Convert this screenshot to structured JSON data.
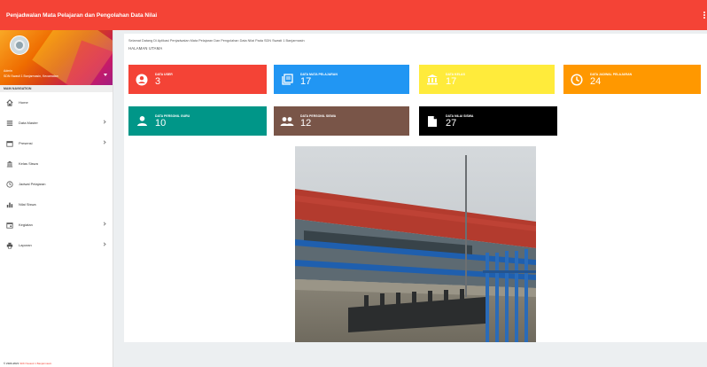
{
  "app": {
    "title": "Penjadwalan Mata Pelajaran dan Pengolahan Data Nilai"
  },
  "sidebar": {
    "user_name": "Admin",
    "user_school": "SDN Swasti 1 Banjarmasin, Kecamatan",
    "nav_header": "MAIN NAVIGATION",
    "items": [
      {
        "label": "Home",
        "icon": "home-icon",
        "has_submenu": false
      },
      {
        "label": "Data Master",
        "icon": "list-icon",
        "has_submenu": true
      },
      {
        "label": "Presensi",
        "icon": "calendar-icon",
        "has_submenu": true
      },
      {
        "label": "Kelas Siswa",
        "icon": "building-icon",
        "has_submenu": false
      },
      {
        "label": "Jadwal Pelajaran",
        "icon": "clock-icon",
        "has_submenu": false
      },
      {
        "label": "Nilai Siswa",
        "icon": "chart-icon",
        "has_submenu": false
      },
      {
        "label": "Kegiatan",
        "icon": "event-icon",
        "has_submenu": true
      },
      {
        "label": "Laporan",
        "icon": "print-icon",
        "has_submenu": true
      }
    ],
    "footer": "© 2020-2021",
    "footer_school": "SDN Swasti 1 Banjarmasin"
  },
  "main": {
    "welcome": "Selamat Datang Di Aplikasi Penjadwalan Mata Pelajaran Dan Pengolahan Data Nilai Pada SDN Swasti 1 Banjarmasin",
    "page_label": "HALAMAN UTAMA",
    "cards": [
      {
        "label": "DATA USER",
        "value": "3",
        "icon": "user-circle-icon",
        "color": "#f44336"
      },
      {
        "label": "DATA MATA PELAJARAN",
        "value": "17",
        "icon": "book-icon",
        "color": "#2196f3"
      },
      {
        "label": "DATA KELAS",
        "value": "17",
        "icon": "bank-icon",
        "color": "#ffeb3b"
      },
      {
        "label": "DATA JADWAL PELAJARAN",
        "value": "24",
        "icon": "clock-icon",
        "color": "#ff9800"
      },
      {
        "label": "DATA PERSONIL GURU",
        "value": "10",
        "icon": "person-icon",
        "color": "#009688"
      },
      {
        "label": "DATA PERSONIL SISWA",
        "value": "12",
        "icon": "group-icon",
        "color": "#795548"
      },
      {
        "label": "DATA NILAI SISWA",
        "value": "27",
        "icon": "document-icon",
        "color": "#000000"
      }
    ]
  }
}
